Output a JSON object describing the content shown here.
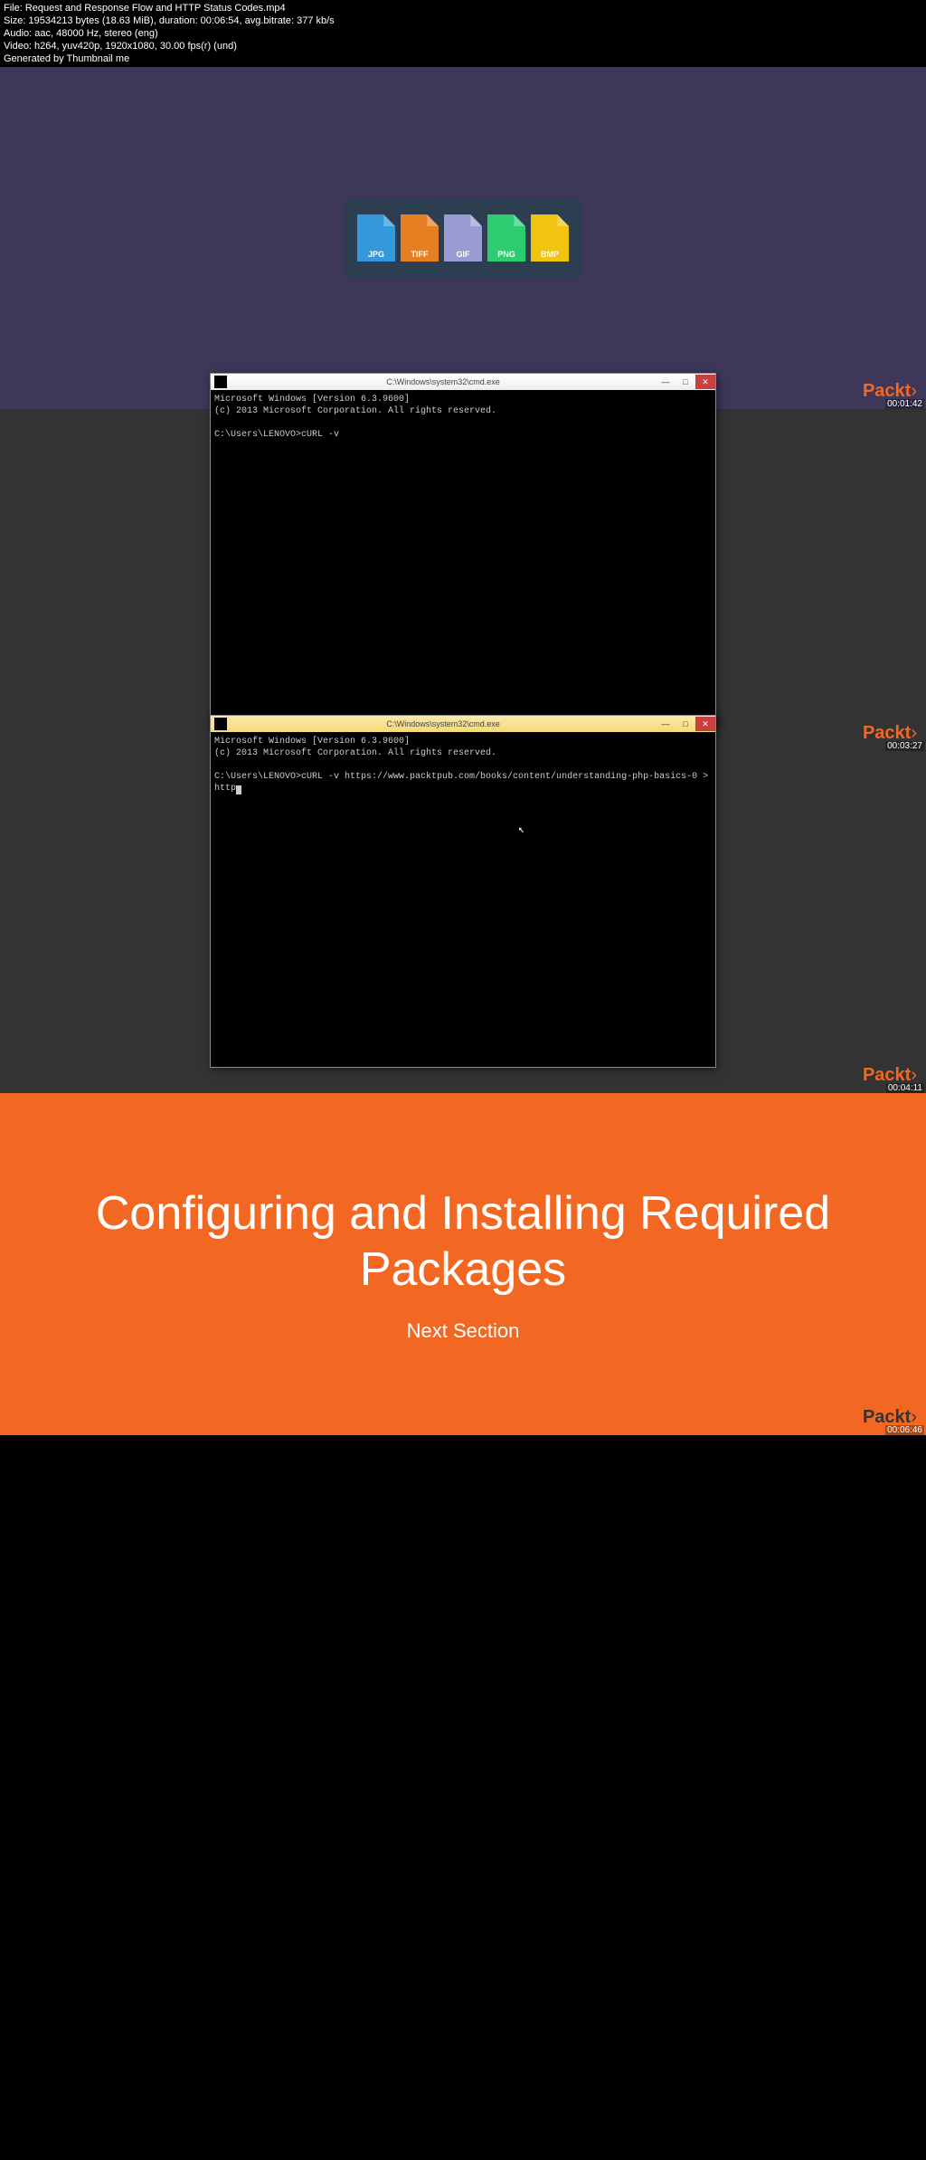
{
  "header": {
    "file": "File: Request and Response Flow and HTTP Status Codes.mp4",
    "size": "Size: 19534213 bytes (18.63 MiB), duration: 00:06:54, avg.bitrate: 377 kb/s",
    "audio": "Audio: aac, 48000 Hz, stereo (eng)",
    "video": "Video: h264, yuv420p, 1920x1080, 30.00 fps(r) (und)",
    "generated": "Generated by Thumbnail me"
  },
  "brand": "Packt",
  "brand_bracket": "›",
  "frames": [
    {
      "timestamp": "00:01:42",
      "file_types": [
        {
          "label": "JPG",
          "class": "jpg"
        },
        {
          "label": "TIFF",
          "class": "tiff"
        },
        {
          "label": "GIF",
          "class": "gif"
        },
        {
          "label": "PNG",
          "class": "png"
        },
        {
          "label": "BMP",
          "class": "bmp"
        }
      ]
    },
    {
      "timestamp": "00:03:27",
      "cmd_title": "C:\\Windows\\system32\\cmd.exe",
      "cmd_text": "Microsoft Windows [Version 6.3.9600]\n(c) 2013 Microsoft Corporation. All rights reserved.\n\nC:\\Users\\LENOVO>cURL -v"
    },
    {
      "timestamp": "00:04:11",
      "cmd_title": "C:\\Windows\\system32\\cmd.exe",
      "cmd_text": "Microsoft Windows [Version 6.3.9600]\n(c) 2013 Microsoft Corporation. All rights reserved.\n\nC:\\Users\\LENOVO>cURL -v https://www.packtpub.com/books/content/understanding-php-basics-0 > http"
    },
    {
      "timestamp": "00:06:46",
      "title": "Configuring and Installing Required Packages",
      "subtitle": "Next Section"
    }
  ],
  "window_controls": {
    "min": "—",
    "max": "□",
    "close": "✕"
  }
}
